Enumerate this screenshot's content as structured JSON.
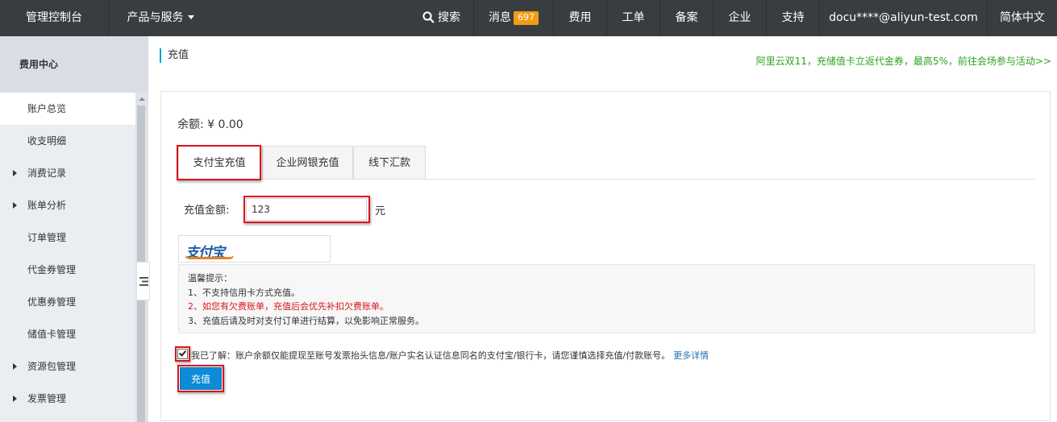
{
  "topnav": {
    "brand": "管理控制台",
    "products": "产品与服务",
    "search": "搜索",
    "messages": "消息",
    "messages_count": "697",
    "fees": "费用",
    "tickets": "工单",
    "filing": "备案",
    "enterprise": "企业",
    "support": "支持",
    "account": "docu****@aliyun-test.com",
    "language": "简体中文"
  },
  "sidebar": {
    "title": "费用中心",
    "items": [
      {
        "label": "账户总览"
      },
      {
        "label": "收支明细"
      },
      {
        "label": "消费记录"
      },
      {
        "label": "账单分析"
      },
      {
        "label": "订单管理"
      },
      {
        "label": "代金券管理"
      },
      {
        "label": "优惠券管理"
      },
      {
        "label": "储值卡管理"
      },
      {
        "label": "资源包管理"
      },
      {
        "label": "发票管理"
      }
    ]
  },
  "main": {
    "title": "充值",
    "promo": "阿里云双11，充储值卡立返代金券，最高5%，前往会场参与活动>>",
    "balance": "余额: ¥ 0.00",
    "tabs": [
      {
        "label": "支付宝充值"
      },
      {
        "label": "企业网银充值"
      },
      {
        "label": "线下汇款"
      }
    ],
    "amount_label": "充值金额:",
    "amount_value": "123",
    "amount_unit": "元",
    "payment_logo": "支付宝",
    "tips": {
      "title": "温馨提示：",
      "line1": "1、不支持信用卡方式充值。",
      "line2": "2、如您有欠费账单，充值后会优先补扣欠费账单。",
      "line3": "3、充值后请及时对支付订单进行结算，以免影响正常服务。"
    },
    "agreement": "我已了解：账户余额仅能提现至账号发票抬头信息/账户实名认证信息同名的支付宝/银行卡，请您谨慎选择充值/付款账号。",
    "more_link": "更多详情",
    "submit": "充值"
  },
  "colors": {
    "nav_bg": "#373d41",
    "badge": "#f39c12",
    "accent": "#0d8bd7",
    "promo": "#2ea320",
    "warning": "#d9141b",
    "highlight_box": "#d9141b"
  }
}
